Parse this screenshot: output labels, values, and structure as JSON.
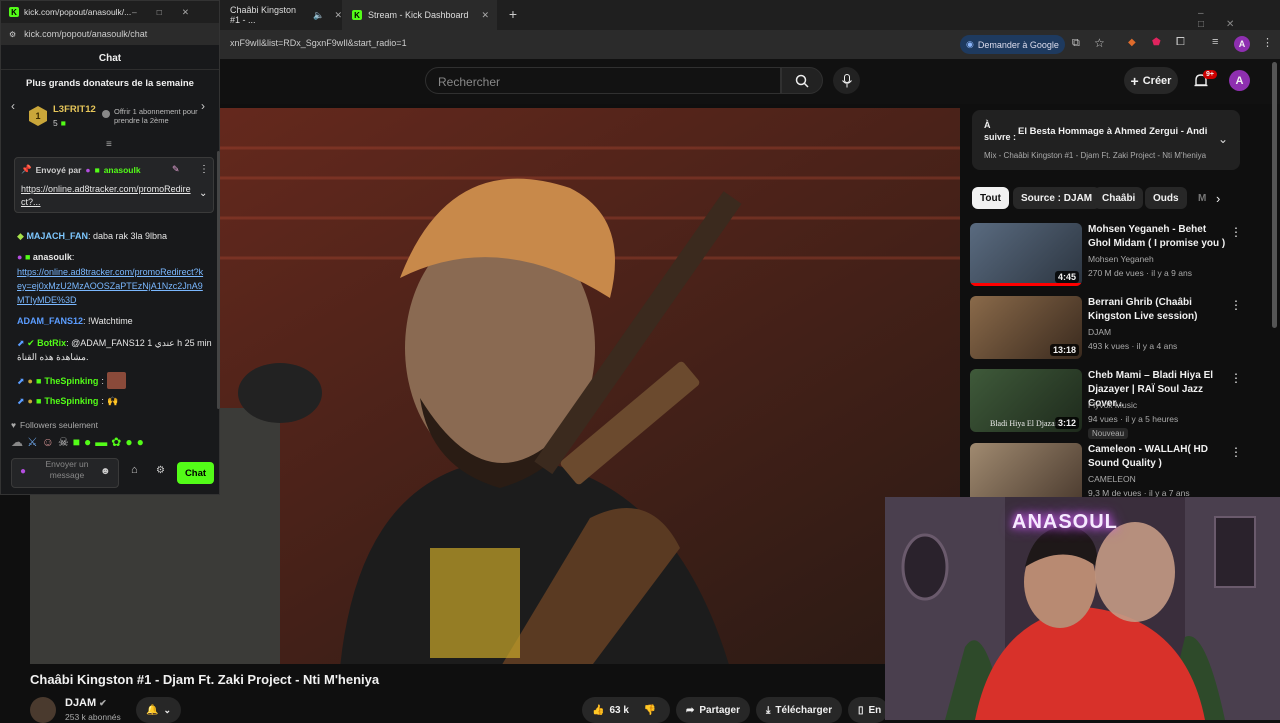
{
  "browser": {
    "tabs": [
      {
        "label": "kick.com/popout/anasoulk/..."
      },
      {
        "label": "Chaâbi Kingston #1 - ..."
      },
      {
        "label": "Stream - Kick Dashboard"
      }
    ],
    "url_popout": "kick.com/popout/anasoulk/chat",
    "url_main": "xnF9wIl&list=RDx_SgxnF9wIl&start_radio=1",
    "translate_label": "Demander à Google",
    "profile_letter": "A"
  },
  "youtube": {
    "search_placeholder": "Rechercher",
    "create_label": "Créer",
    "notif_badge": "9+",
    "avatar_letter": "A",
    "next_up": {
      "prefix_line1": "À",
      "prefix_line2": "suivre :",
      "title": "El Besta Hommage à Ahmed Zergui - Andi ...",
      "subtitle": "Mix - Chaâbi Kingston #1 - Djam Ft. Zaki Project - Nti M'heniya"
    },
    "chips": [
      "Tout",
      "Source : DJAM",
      "Chaâbi",
      "Ouds",
      "M"
    ],
    "recommendations": [
      {
        "title": "Mohsen Yeganeh - Behet Ghol Midam ( I promise you )",
        "channel": "Mohsen Yeganeh",
        "meta": "270 M de vues · il y a 9 ans",
        "duration": "4:45",
        "badge": ""
      },
      {
        "title": "Berrani Ghrib (Chaâbi Kingston Live session)",
        "channel": "DJAM",
        "meta": "493 k vues · il y a 4 ans",
        "duration": "13:18",
        "badge": ""
      },
      {
        "title": "Cheb Mami – Bladi Hiya El Djazayer | RAÏ Soul Jazz Cover...",
        "channel": "Flyvox Music",
        "meta": "94 vues · il y a 5 heures",
        "duration": "3:12",
        "badge": "Nouveau",
        "thumb_text": "Bladi Hiya El Djazair"
      },
      {
        "title": "Cameleon - WALLAH( HD Sound Quality )",
        "channel": "CAMELEON",
        "meta": "9,3 M de vues · il y a 7 ans",
        "duration": "",
        "badge": ""
      }
    ],
    "video_title": "Chaâbi Kingston #1 - Djam Ft. Zaki Project - Nti M'heniya",
    "channel_name": "DJAM",
    "subscribers": "253 k abonnés",
    "likes": "63 k",
    "share_label": "Partager",
    "download_label": "Télécharger",
    "more_label": "En"
  },
  "chat": {
    "title": "Chat",
    "top_donors_title": "Plus grands donateurs de la semaine",
    "donor_name": "L3FRIT12",
    "donor_count": "5",
    "donor_offer": "Offrir 1 abonnement pour prendre la 2ème",
    "pinned_by_label": "Envoyé par",
    "pinned_by_user": "anasoulk",
    "pinned_link": "https://online.ad8tracker.com/promoRedirect?...",
    "messages": [
      {
        "user": "MAJACH_FAN",
        "text": ": daba rak 3la 9lbna",
        "color": "#7ec8ff"
      },
      {
        "user": "anasoulk",
        "text": ":",
        "color": "#e6e6e6"
      },
      {
        "user": "",
        "text": "https://online.ad8tracker.com/promoRedirect?key=ej0xMzU2MzAOOSZaPTEzNjA1Nzc2JnA9MTIyMDE%3D",
        "color": "#7ab8ff"
      },
      {
        "user": "ADAM_FANS12",
        "text": ": !Watchtime",
        "color": "#5b9dff"
      },
      {
        "user": "BotRix",
        "text": ": @ADAM_FANS12 1 عندي h 25 min مشاهدة هذه القناة.",
        "color": "#53fc18"
      },
      {
        "user": "TheSpinking",
        "text": ":",
        "color": "#53fc18"
      },
      {
        "user": "TheSpinking",
        "text": ":",
        "color": "#53fc18"
      }
    ],
    "followers_only": "Followers seulement",
    "input_placeholder": "Envoyer un message",
    "send_label": "Chat"
  },
  "webcam": {
    "neon_text": "ANASOUL"
  },
  "colors": {
    "kick_green": "#53fc18",
    "yt_red": "#ff0000"
  }
}
